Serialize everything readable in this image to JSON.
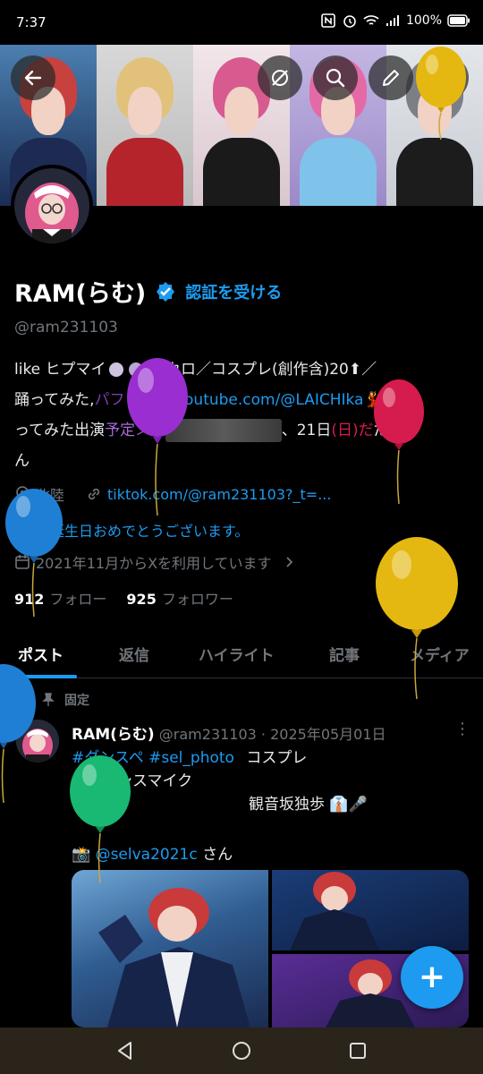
{
  "status_bar": {
    "time": "7:37",
    "battery": "100%"
  },
  "banner": {
    "panels": [
      {
        "hair": "#c7413f",
        "body": "#1d2a52"
      },
      {
        "hair": "#e2c27a",
        "body": "#b6242b"
      },
      {
        "hair": "#d75b8f",
        "body": "#1a1a1a"
      },
      {
        "hair": "#e46aa6",
        "body": "#7fc3ea"
      },
      {
        "hair": "#7b7f86",
        "body": "#1c1c1c"
      }
    ]
  },
  "profile": {
    "name": "RAM(らむ)",
    "verify_link": "認証を受ける",
    "handle": "@ram231103",
    "bio_line1": "like ヒプマイ",
    "bio_line1b": ",ボカロ／コスプレ(創作含)20⬆／",
    "bio_line2": "踊ってみた,",
    "bio_line2_faded": "パフォ動画",
    "bio_link": "youtube.com/@LAICHIka",
    "bio_line2_end": "💃踊",
    "bio_line3": "ってみた出演",
    "bio_line3_faded": "予定＞6/",
    "bio_line3_end": "、21日",
    "bio_line3_pink": "(日)だ",
    "bio_line3_tail": "だだ",
    "bio_line4": "ん",
    "location": "北陸",
    "link": "tiktok.com/@ram231103?_t=...",
    "birthday": "お誕生日おめでとうございます。",
    "joined": "2021年11月からXを利用しています",
    "following_count": "912",
    "following_label": "フォロー",
    "followers_count": "925",
    "followers_label": "フォロワー"
  },
  "tabs": [
    "ポスト",
    "返信",
    "ハイライト",
    "記事",
    "メディア"
  ],
  "pinned_post": {
    "pinned_label": "固定",
    "author": "RAM(らむ)",
    "meta": "@ram231103 · 2025年05月01日",
    "tag1": "#ダンスペ",
    "tag2": "#sel_photo",
    "text1": "コスプレ",
    "text2": "ヒプノシスマイク",
    "text3": "観音坂独歩 👔🎤",
    "credit_prefix": "📸",
    "credit_link": "@selva2021c",
    "credit_suffix": "さん"
  },
  "fab_label": "+",
  "colors": {
    "accent": "#1d9bf0",
    "text": "#e7e9ea",
    "muted": "#71767b",
    "background": "#000000"
  },
  "balloons": [
    {
      "color": "#e5b811",
      "name": "yellow"
    },
    {
      "color": "#9a2ed0",
      "name": "purple"
    },
    {
      "color": "#d61c4e",
      "name": "red"
    },
    {
      "color": "#1f7fd4",
      "name": "blue"
    },
    {
      "color": "#e5b811",
      "name": "yellow"
    },
    {
      "color": "#1f7fd4",
      "name": "blue"
    },
    {
      "color": "#19b873",
      "name": "green"
    }
  ]
}
